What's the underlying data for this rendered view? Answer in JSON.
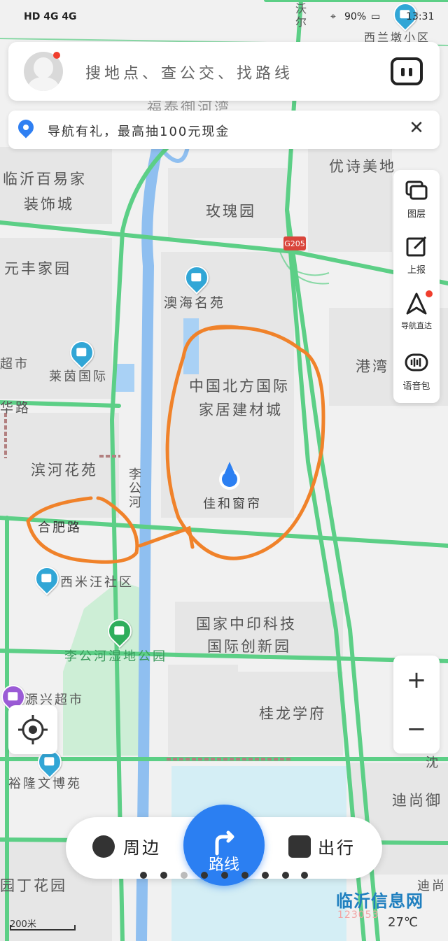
{
  "status_bar": {
    "left": "HD 4G 4G",
    "battery": "90%",
    "time": "13:31"
  },
  "search": {
    "placeholder": "搜地点、查公交、找路线",
    "assistant_icon": "voice-assistant-icon"
  },
  "promo": {
    "text": "导航有礼，最高抽100元现金"
  },
  "map_labels": {
    "xilandun": "西兰墩小区",
    "fuqin": "福泰御河湾",
    "linyi_baiyi": "临沂百易家",
    "zhuangshi": "装饰城",
    "youshi": "优诗美地",
    "meigui": "玫瑰园",
    "yuanfeng": "元丰家园",
    "aohai": "澳海名苑",
    "chaoshi_left": "超市",
    "laiyin": "莱茵国际",
    "gangwan": "港湾",
    "huarao": "华路",
    "beifang": "中国北方国际",
    "jiaju": "家居建材城",
    "binhe": "滨河花苑",
    "ligonghe_vertical": "李公河",
    "jiahe": "佳和窗帘",
    "hefei": "合肥路",
    "ximiwang": "西米汪社区",
    "zhongyin": "国家中印科技",
    "chuangxin": "国际创新园",
    "wetland": "李公河湿地公园",
    "yuanxing": "源兴超市",
    "guilong": "桂龙学府",
    "yulong": "裕隆文博苑",
    "dishang": "迪尚御",
    "dishang2": "迪尚",
    "yuanding": "园丁花园",
    "shen": "沈",
    "g205": "G205",
    "watu": "沃尔"
  },
  "tools": {
    "layers": "图层",
    "report": "上报",
    "nav_direct": "导航直达",
    "voice_pack": "语音包"
  },
  "zoom": {
    "in": "+",
    "out": "−"
  },
  "bottom": {
    "nearby": "周边",
    "route": "路线",
    "travel": "出行"
  },
  "scale": "200米",
  "watermark": "临沂信息网",
  "watermark_sub": "123053",
  "weather": "27℃",
  "colors": {
    "road": "#5ccf86",
    "river": "#8fbff0",
    "annotation": "#f0822a",
    "accent": "#2b7ff2"
  }
}
